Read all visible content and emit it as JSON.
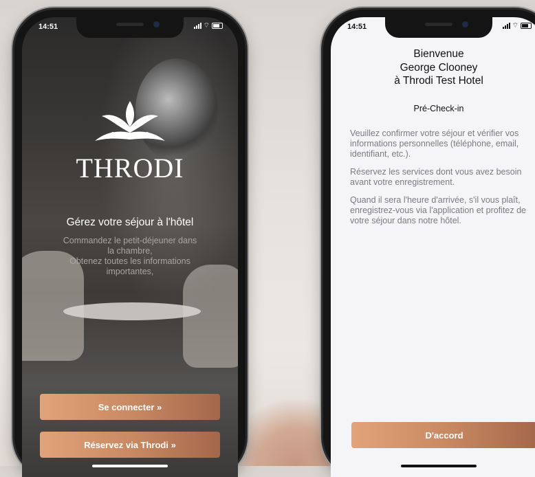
{
  "left_phone": {
    "status": {
      "time": "14:51"
    },
    "brand": "THRODI",
    "tagline": "Gérez votre séjour à l'hôtel",
    "subtext": "Commandez le petit-déjeuner dans\nla chambre,\nObtenez toutes les informations\nimportantes,",
    "buttons": {
      "connect": "Se connecter »",
      "reserve": "Réservez via Throdi »"
    }
  },
  "right_phone": {
    "status": {
      "time": "14:51"
    },
    "welcome": {
      "line1": "Bienvenue",
      "line2": "George Clooney",
      "line3": "à Throdi Test Hotel"
    },
    "section_title": "Pré-Check-in",
    "paragraphs": [
      "Veuillez confirmer votre séjour et vérifier vos informations personnelles (téléphone, email, identifiant, etc.).",
      "Réservez les services dont vous avez besoin avant votre enregistrement.",
      "Quand il sera l'heure d'arrivée, s'il vous plaît, enregistrez-vous via l'application et profitez de votre séjour dans notre hôtel."
    ],
    "buttons": {
      "ok": "D'accord"
    }
  },
  "colors": {
    "accent_start": "#e2a27a",
    "accent_end": "#a5674a",
    "text_muted": "#7a7a80"
  },
  "icons": [
    "signal-icon",
    "wifi-icon",
    "battery-icon",
    "lotus-logo-icon"
  ]
}
